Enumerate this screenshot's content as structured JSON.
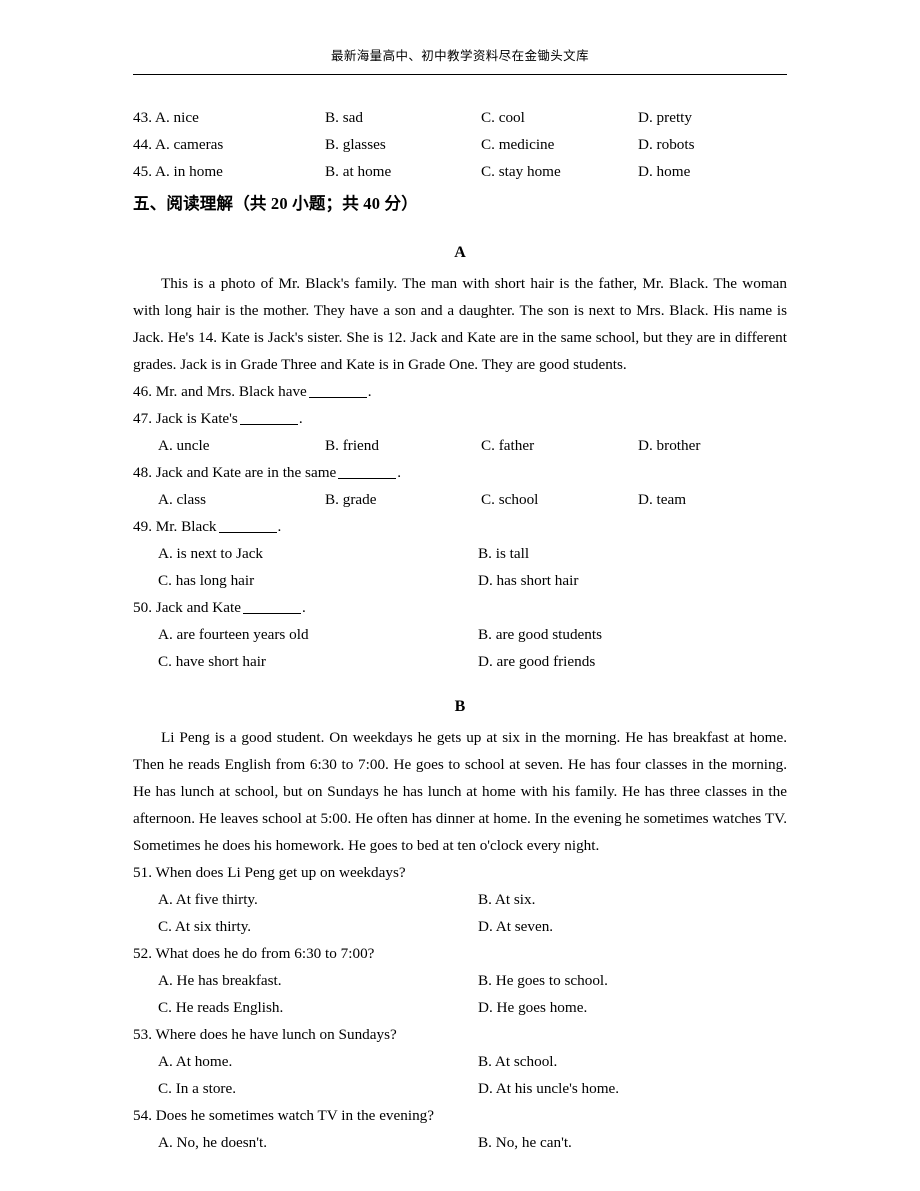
{
  "header": {
    "watermark_text": "最新海量高中、初中教学资料尽在金锄头文库"
  },
  "cloze_tail": {
    "rows": [
      {
        "num": "43.",
        "a": "A. nice",
        "b": "B. sad",
        "c": "C. cool",
        "d": "D. pretty"
      },
      {
        "num": "44.",
        "a": "A. cameras",
        "b": "B. glasses",
        "c": "C. medicine",
        "d": "D. robots"
      },
      {
        "num": "45.",
        "a": "A. in home",
        "b": "B. at home",
        "c": "C. stay home",
        "d": "D. home"
      }
    ]
  },
  "section": {
    "heading": "五、阅读理解（共 20 小题；共 40 分）"
  },
  "passage_a": {
    "label": "A",
    "text": "This is a photo of Mr. Black's family. The man with short hair is the father, Mr. Black. The woman with long hair is the mother. They have a son and a daughter. The son is next to Mrs. Black. His name is Jack. He's 14. Kate is Jack's sister. She is 12. Jack and Kate are in the same school, but they are in different grades. Jack is in Grade Three and Kate is in Grade One. They are good students.",
    "questions": [
      {
        "stem_pre": "46. Mr. and Mrs. Black have",
        "stem_post": ".",
        "layout": "none",
        "options": []
      },
      {
        "stem_pre": "47. Jack is Kate's",
        "stem_post": ".",
        "layout": "four",
        "options": [
          "A. uncle",
          "B. friend",
          "C. father",
          "D. brother"
        ]
      },
      {
        "stem_pre": "48. Jack and Kate are in the same",
        "stem_post": ".",
        "layout": "four",
        "options": [
          "A. class",
          "B. grade",
          "C. school",
          "D. team"
        ]
      },
      {
        "stem_pre": "49. Mr. Black",
        "stem_post": ".",
        "layout": "two",
        "options": [
          "A. is next to Jack",
          "B. is tall",
          "C. has long hair",
          "D. has short hair"
        ]
      },
      {
        "stem_pre": "50. Jack and Kate",
        "stem_post": ".",
        "layout": "two",
        "options": [
          "A. are fourteen years old",
          "B. are good students",
          "C. have short hair",
          "D. are good friends"
        ]
      }
    ]
  },
  "passage_b": {
    "label": "B",
    "text": "Li Peng is a good student. On weekdays he gets up at six in the morning. He has breakfast at home. Then he reads English from 6:30 to 7:00. He goes to school at seven. He has four classes in the morning. He has lunch at school, but on Sundays he has lunch at home with his family. He has three classes in the afternoon. He leaves school at 5:00. He often has dinner at home. In the evening he sometimes watches TV. Sometimes he does his homework. He goes to bed at ten o'clock every night.",
    "questions": [
      {
        "stem": "51. When does Li Peng get up on weekdays?",
        "layout": "two",
        "options": [
          "A. At five thirty.",
          "B. At six.",
          "C. At six thirty.",
          "D. At seven."
        ]
      },
      {
        "stem": "52. What does he do from 6:30 to 7:00?",
        "layout": "two",
        "options": [
          "A. He has breakfast.",
          "B. He goes to school.",
          "C. He reads English.",
          "D. He goes home."
        ]
      },
      {
        "stem": "53. Where does he have lunch on Sundays?",
        "layout": "two",
        "options": [
          "A. At home.",
          "B. At school.",
          "C. In a store.",
          "D. At his uncle's home."
        ]
      },
      {
        "stem": "54. Does he sometimes watch TV in the evening?",
        "layout": "two-partial",
        "options": [
          "A. No, he doesn't.",
          "B. No, he can't."
        ]
      }
    ]
  }
}
